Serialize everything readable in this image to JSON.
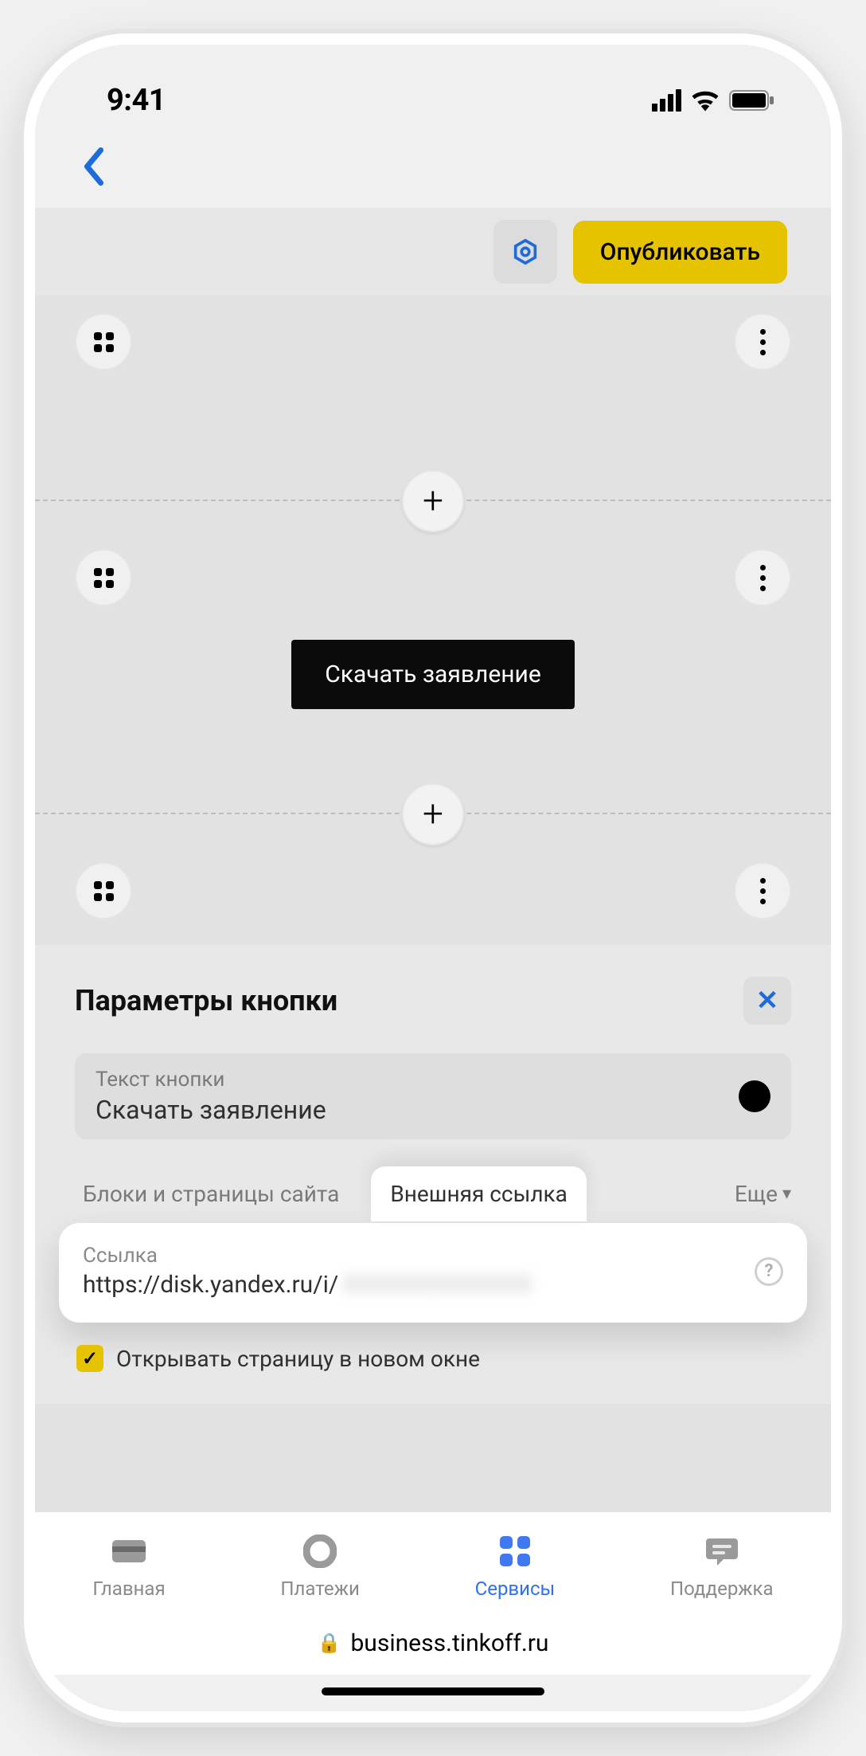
{
  "status": {
    "time": "9:41"
  },
  "toolbar": {
    "publish_label": "Опубликовать"
  },
  "editor": {
    "download_label": "Скачать заявление"
  },
  "params": {
    "title": "Параметры кнопки",
    "text_label": "Текст кнопки",
    "text_value": "Скачать заявление",
    "color": "#000000",
    "tabs": {
      "blocks": "Блоки и страницы сайта",
      "external": "Внешняя ссылка",
      "more": "Еще"
    },
    "link_label": "Ссылка",
    "link_value": "https://disk.yandex.ru/i/",
    "open_new_window": "Открывать страницу в новом окне"
  },
  "bottom_nav": {
    "home": "Главная",
    "payments": "Платежи",
    "services": "Сервисы",
    "support": "Поддержка"
  },
  "url_bar": "business.tinkoff.ru"
}
